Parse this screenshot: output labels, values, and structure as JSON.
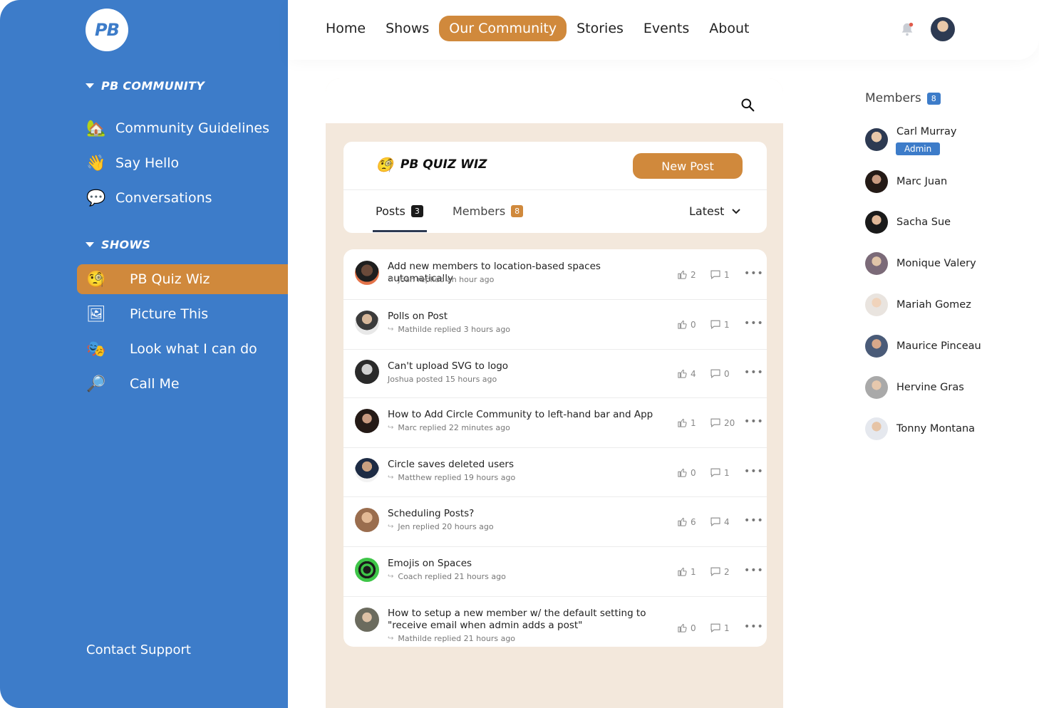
{
  "sidebar": {
    "logo": "PB",
    "section_community": "PB COMMUNITY",
    "community_items": [
      {
        "label": "Community Guidelines",
        "icon": "house-tree-icon"
      },
      {
        "label": "Say Hello",
        "icon": "waving-hand-icon"
      },
      {
        "label": "Conversations",
        "icon": "speech-bubble-icon"
      }
    ],
    "section_shows": "SHOWS",
    "show_items": [
      {
        "label": "PB Quiz Wiz",
        "icon": "face-with-monocle-icon",
        "active": true
      },
      {
        "label": "Picture This",
        "icon": "framed-picture-icon",
        "active": false
      },
      {
        "label": "Look what I can do",
        "icon": "performing-arts-icon",
        "active": false
      },
      {
        "label": "Call Me",
        "icon": "magnifying-glass-icon",
        "active": false
      }
    ],
    "contact": "Contact Support"
  },
  "topnav": {
    "items": [
      "Home",
      "Shows",
      "Our Community",
      "Stories",
      "Events",
      "About"
    ],
    "active": "Our Community"
  },
  "space": {
    "title": "PB QUIZ WIZ",
    "new_post": "New Post",
    "tab_posts": "Posts",
    "posts_count": "3",
    "tab_members": "Members",
    "members_count": "8",
    "sort": "Latest"
  },
  "posts": [
    {
      "title": "Add new members to location-based spaces automatically",
      "meta": "Joan replied an hour ago",
      "likes": "2",
      "comments": "1"
    },
    {
      "title": "Polls on Post",
      "meta": "Mathilde replied 3 hours ago",
      "likes": "0",
      "comments": "1"
    },
    {
      "title": "Can't upload SVG to logo",
      "meta": "Joshua posted 15 hours ago",
      "likes": "4",
      "comments": "0"
    },
    {
      "title": "How to Add Circle Community to left-hand bar and App",
      "meta": "Marc replied 22 minutes ago",
      "likes": "1",
      "comments": "20"
    },
    {
      "title": "Circle saves deleted users",
      "meta": "Matthew replied 19 hours ago",
      "likes": "0",
      "comments": "1"
    },
    {
      "title": "Scheduling Posts?",
      "meta": "Jen replied 20 hours ago",
      "likes": "6",
      "comments": "4"
    },
    {
      "title": "Emojis on Spaces",
      "meta": "Coach replied 21 hours ago",
      "likes": "1",
      "comments": "2"
    },
    {
      "title": "How to setup a new member w/ the default setting to \"receive email when admin adds a post\"",
      "meta": "Mathilde replied 21 hours ago",
      "likes": "0",
      "comments": "1"
    }
  ],
  "members_panel": {
    "title": "Members",
    "count": "8",
    "admin_label": "Admin",
    "members": [
      "Carl Murray",
      "Marc Juan",
      "Sacha Sue",
      "Monique Valery",
      "Mariah Gomez",
      "Maurice Pinceau",
      "Hervine Gras",
      "Tonny Montana"
    ]
  },
  "colors": {
    "sidebar": "#3d7cc9",
    "accent": "#d0893c",
    "panel_bg": "#f3e8dc"
  }
}
